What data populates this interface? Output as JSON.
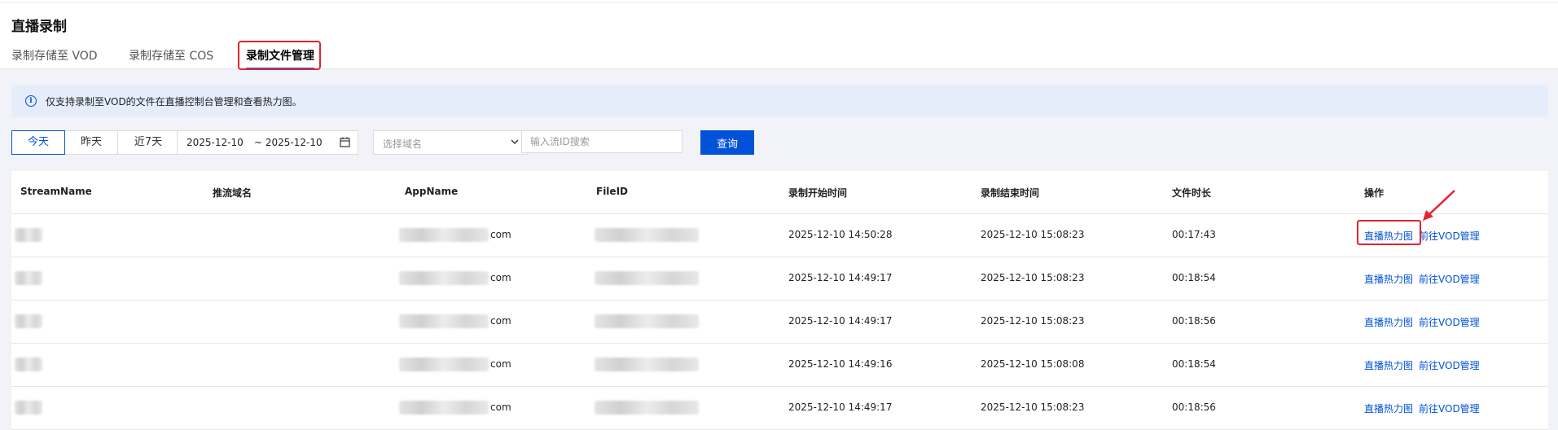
{
  "page": {
    "title": "直播录制"
  },
  "tabs": [
    {
      "label": "录制存储至 VOD",
      "active": false
    },
    {
      "label": "录制存储至 COS",
      "active": false
    },
    {
      "label": "录制文件管理",
      "active": true
    }
  ],
  "notice": {
    "text": "仅支持录制至VOD的文件在直播控制台管理和查看热力图。",
    "icon": "info-icon"
  },
  "filters": {
    "range_buttons": [
      "今天",
      "昨天",
      "近7天"
    ],
    "active_range": "今天",
    "start_date": "2025-12-10",
    "end_date": "~ 2025-12-10",
    "domain_select_placeholder": "选择域名",
    "search_placeholder": "输入流ID搜索",
    "query_label": "查询"
  },
  "table": {
    "columns": [
      "StreamName",
      "推流域名",
      "AppName",
      "FileID",
      "录制开始时间",
      "录制结束时间",
      "文件时长",
      "操作"
    ],
    "rows": [
      {
        "app_suffix": "com",
        "start": "2025-12-10 14:50:28",
        "end": "2025-12-10 15:08:23",
        "duration": "00:17:43",
        "action1": "直播热力图",
        "action2": "前往VOD管理"
      },
      {
        "app_suffix": "com",
        "start": "2025-12-10 14:49:17",
        "end": "2025-12-10 15:08:23",
        "duration": "00:18:54",
        "action1": "直播热力图",
        "action2": "前往VOD管理"
      },
      {
        "app_suffix": "com",
        "start": "2025-12-10 14:49:17",
        "end": "2025-12-10 15:08:23",
        "duration": "00:18:56",
        "action1": "直播热力图",
        "action2": "前往VOD管理"
      },
      {
        "app_suffix": "com",
        "start": "2025-12-10 14:49:16",
        "end": "2025-12-10 15:08:08",
        "duration": "00:18:54",
        "action1": "直播热力图",
        "action2": "前往VOD管理"
      },
      {
        "app_suffix": "com",
        "start": "2025-12-10 14:49:17",
        "end": "2025-12-10 15:08:23",
        "duration": "00:18:56",
        "action1": "直播热力图",
        "action2": "前往VOD管理"
      }
    ]
  },
  "colors": {
    "primary": "#0052d9",
    "highlight": "#e6232d",
    "notice_bg": "#e5edfb"
  }
}
